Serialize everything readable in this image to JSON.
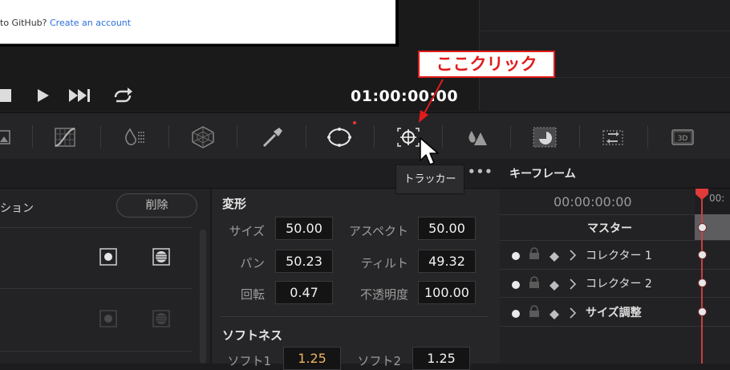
{
  "viewer": {
    "signup_prefix": "to GitHub?",
    "signup_link": "Create an account"
  },
  "transport": {
    "stop_icon": "stop-icon",
    "play_icon": "play-icon",
    "next_icon": "skip-next-icon",
    "loop_icon": "loop-icon",
    "timecode": "01:00:00:00"
  },
  "toolbar": {
    "icons": [
      "image-icon",
      "curves-icon",
      "color-warper-icon",
      "hsl-qualifier-icon",
      "eyedropper-icon",
      "window-icon",
      "tracker-icon",
      "blur-icon",
      "key-icon",
      "sizing-icon",
      "stereo-3d-icon"
    ],
    "tracker_tooltip": "トラッカー"
  },
  "annotation": {
    "callout_text": "ここクリック",
    "color": "#e21b1b"
  },
  "left_panel": {
    "label": "ション",
    "delete_label": "削除"
  },
  "header": {
    "more_label": "•••",
    "keyframes_title": "キーフレーム"
  },
  "transform": {
    "title": "変形",
    "size_label": "サイズ",
    "size_value": "50.00",
    "aspect_label": "アスペクト",
    "aspect_value": "50.00",
    "pan_label": "パン",
    "pan_value": "50.23",
    "tilt_label": "ティルト",
    "tilt_value": "49.32",
    "rotate_label": "回転",
    "rotate_value": "0.47",
    "opacity_label": "不透明度",
    "opacity_value": "100.00"
  },
  "softness": {
    "title": "ソフトネス",
    "soft1_label": "ソフト1",
    "soft1_value": "1.25",
    "soft2_label": "ソフト2",
    "soft2_value": "1.25"
  },
  "keyframes": {
    "timecode": "00:00:00:00",
    "ruler_label": "00:",
    "master_label": "マスター",
    "rows": [
      {
        "label": "コレクター 1"
      },
      {
        "label": "コレクター 2"
      },
      {
        "label": "サイズ調整"
      }
    ]
  }
}
